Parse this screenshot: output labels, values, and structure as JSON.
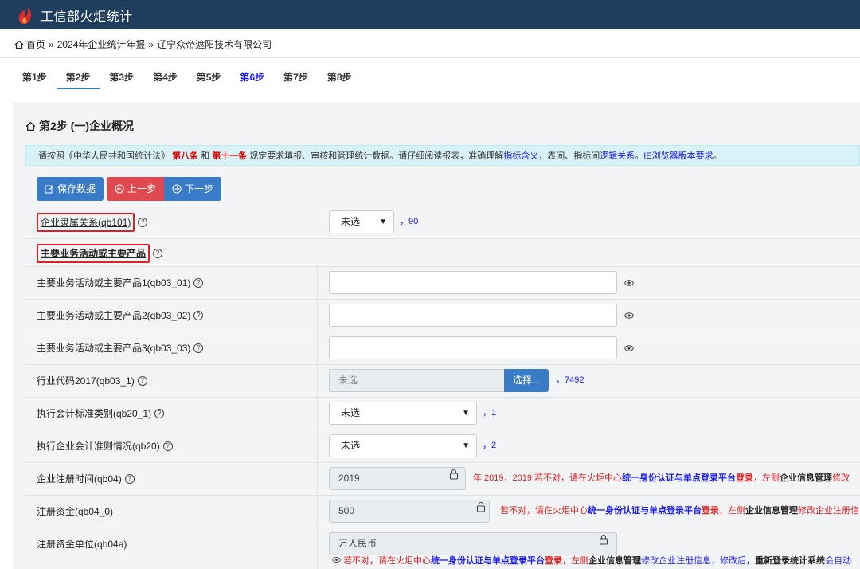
{
  "app": {
    "title": "工信部火炬统计"
  },
  "breadcrumb": {
    "home": "首页",
    "sep": "»",
    "level2": "2024年企业统计年报",
    "level3": "辽宁众帝遮阳技术有限公司"
  },
  "steps": [
    {
      "label": "第1步"
    },
    {
      "label": "第2步"
    },
    {
      "label": "第3步"
    },
    {
      "label": "第4步"
    },
    {
      "label": "第5步"
    },
    {
      "label": "第6步"
    },
    {
      "label": "第7步"
    },
    {
      "label": "第8步"
    }
  ],
  "panel": {
    "title": "第2步 (一)企业概况",
    "notice": {
      "p1": "请按照《中华人民共和国统计法》",
      "art8": "第八条",
      "and": "和",
      "art11": "第十一条",
      "p2": "规定要求填报、审核和管理统计数据。请仔细阅读报表，准确理解",
      "link1": "指标含义",
      "p3": "，表间、指标间",
      "link2": "逻辑关系",
      "p4": "。",
      "link3": "IE浏览器版本要求",
      "p5": "。"
    },
    "buttons": {
      "save": "保存数据",
      "prev": "上一步",
      "next": "下一步"
    }
  },
  "fields": {
    "qb101": {
      "label": "企业隶属关系(qb101)",
      "value": "未选",
      "code": "，90"
    },
    "section": {
      "label": "主要业务活动或主要产品"
    },
    "qb03_01": {
      "label": "主要业务活动或主要产品1(qb03_01)",
      "value": ""
    },
    "qb03_02": {
      "label": "主要业务活动或主要产品2(qb03_02)",
      "value": ""
    },
    "qb03_03": {
      "label": "主要业务活动或主要产品3(qb03_03)",
      "value": ""
    },
    "qb03_1": {
      "label": "行业代码2017(qb03_1)",
      "value": "未选",
      "button": "选择...",
      "code": "，7492"
    },
    "qb20_1": {
      "label": "执行会计标准类别(qb20_1)",
      "value": "未选",
      "code": "，1"
    },
    "qb20": {
      "label": "执行企业会计准则情况(qb20)",
      "value": "未选",
      "code": "，2"
    },
    "qb04": {
      "label": "企业注册时间(qb04)",
      "value": "2019",
      "warn": {
        "a": "年 2019，2019 若不对，请在火炬中心",
        "b": "统一身份认证与单点登录平台",
        "c": "登录",
        "d": "，左侧",
        "e": "企业信息管理",
        "f": "修改"
      }
    },
    "qb04_0": {
      "label": "注册资金(qb04_0)",
      "value": "500",
      "warn": {
        "a": "若不对，请在火炬中心",
        "b": "统一身份认证与单点登录平台",
        "c": "登录",
        "d": "，左侧",
        "e": "企业信息管理",
        "f": "修改企业注册信"
      }
    },
    "qb04a": {
      "label": "注册资金单位(qb04a)",
      "value": "万人民币",
      "warn": {
        "a": "若不对，请在火炬中心",
        "b": "统一身份认证与单点登录平台",
        "c": "登录",
        "d": "，左侧",
        "e": "企业信息管理",
        "f": "修改企业注册信息，修改后，",
        "g": "重新登录统计系统",
        "h": "会自动"
      }
    }
  },
  "colors": {
    "header": "#1f3d5c",
    "primary": "#3a7bc8",
    "danger": "#e0494f",
    "notice_bg": "#d9f2f7",
    "highlight": "#e02020"
  }
}
